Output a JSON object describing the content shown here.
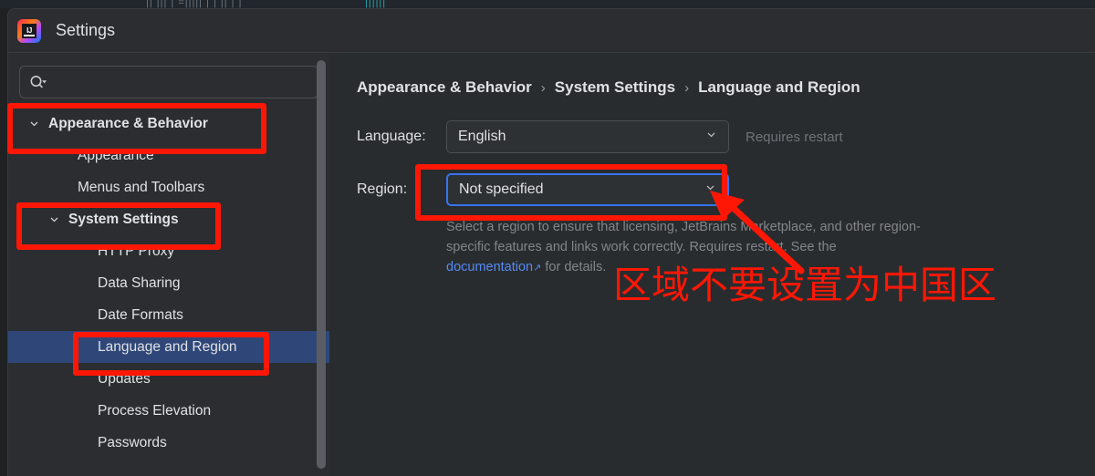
{
  "background_window": {
    "ghost_text": "|| ||| | =||||| | | || | |",
    "ghost_teal": "||||||"
  },
  "window": {
    "title": "Settings",
    "logo_text": "IJ",
    "logo_name": "intellij-idea-logo"
  },
  "sidebar": {
    "search": {
      "placeholder": "",
      "value": "",
      "icon": "search-icon"
    },
    "scrollbar": {
      "name": "sidebar-scrollbar"
    },
    "items": [
      {
        "label": "Appearance & Behavior",
        "type": "group",
        "expanded": true,
        "selected": false
      },
      {
        "label": "Appearance",
        "type": "child",
        "selected": false
      },
      {
        "label": "Menus and Toolbars",
        "type": "child",
        "selected": false
      },
      {
        "label": "System Settings",
        "type": "group-sub",
        "expanded": true,
        "selected": false
      },
      {
        "label": "HTTP Proxy",
        "type": "child2",
        "selected": false
      },
      {
        "label": "Data Sharing",
        "type": "child2",
        "selected": false
      },
      {
        "label": "Date Formats",
        "type": "child2",
        "selected": false
      },
      {
        "label": "Language and Region",
        "type": "child2",
        "selected": true
      },
      {
        "label": "Updates",
        "type": "child2",
        "selected": false
      },
      {
        "label": "Process Elevation",
        "type": "child2",
        "selected": false
      },
      {
        "label": "Passwords",
        "type": "child2",
        "selected": false
      }
    ]
  },
  "main": {
    "breadcrumb": {
      "items": [
        "Appearance & Behavior",
        "System Settings",
        "Language and Region"
      ],
      "separator": "›"
    },
    "language_row": {
      "label": "Language:",
      "value": "English",
      "hint": "Requires restart"
    },
    "region_row": {
      "label": "Region:",
      "value": "Not specified",
      "focused": true
    },
    "help": {
      "part1": "Select a region to ensure that licensing, JetBrains Marketplace, and other region-specific features and links work correctly. Requires restart. See the ",
      "link": "documentation",
      "link_arrow": "↗",
      "part2": " for details."
    }
  },
  "annotations": {
    "cjk_note": "区域不要设置为中国区",
    "color": "#fe1705",
    "boxes": [
      "appearance-and-behavior",
      "system-settings",
      "language-and-region",
      "region-dropdown"
    ],
    "arrow": "arrow-pointing-to-region-dropdown"
  },
  "colors": {
    "accent_blue": "#3574f0",
    "selection_blue": "#2f4778",
    "annotation_red": "#fe1705",
    "link_blue": "#548af7",
    "panel_bg": "#292c2e",
    "sidebar_bg": "#2b2d30"
  }
}
